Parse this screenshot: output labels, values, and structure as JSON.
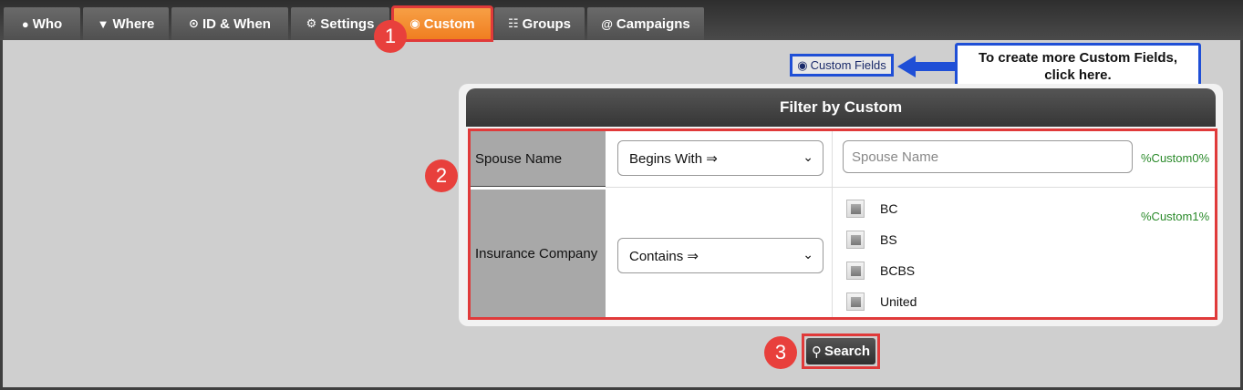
{
  "tabs": [
    {
      "icon": "user-icon",
      "glyph": "👤",
      "label": "Who"
    },
    {
      "icon": "map-pin-icon",
      "glyph": "📍",
      "label": "Where"
    },
    {
      "icon": "clock-icon",
      "glyph": "⊙",
      "label": "ID & When"
    },
    {
      "icon": "gear-icon",
      "glyph": "⚙",
      "label": "Settings"
    },
    {
      "icon": "target-icon",
      "glyph": "◉",
      "label": "Custom"
    },
    {
      "icon": "group-icon",
      "glyph": "☷",
      "label": "Groups"
    },
    {
      "icon": "at-icon",
      "glyph": "@",
      "label": "Campaigns"
    }
  ],
  "badges": [
    "1",
    "2",
    "3"
  ],
  "custom_fields_link": {
    "glyph": "◉",
    "label": "Custom Fields"
  },
  "callout": {
    "line1": "To create more Custom Fields,",
    "line2": "click here."
  },
  "panel": {
    "title": "Filter by Custom",
    "rows": [
      {
        "label": "Spouse Name",
        "operator": "Begins With ⇒",
        "placeholder": "Spouse Name",
        "tag": "%Custom0%"
      },
      {
        "label": "Insurance Company",
        "operator": "Contains ⇒",
        "options": [
          "BC",
          "BS",
          "BCBS",
          "United"
        ],
        "tag": "%Custom1%"
      }
    ]
  },
  "search_button": {
    "glyph": "🔍",
    "label": "Search"
  },
  "colors": {
    "accent": "#f07d1f",
    "highlight": "#e03a3a",
    "callout_blue": "#1f4fd6",
    "tag_green": "#2a8a2a"
  }
}
